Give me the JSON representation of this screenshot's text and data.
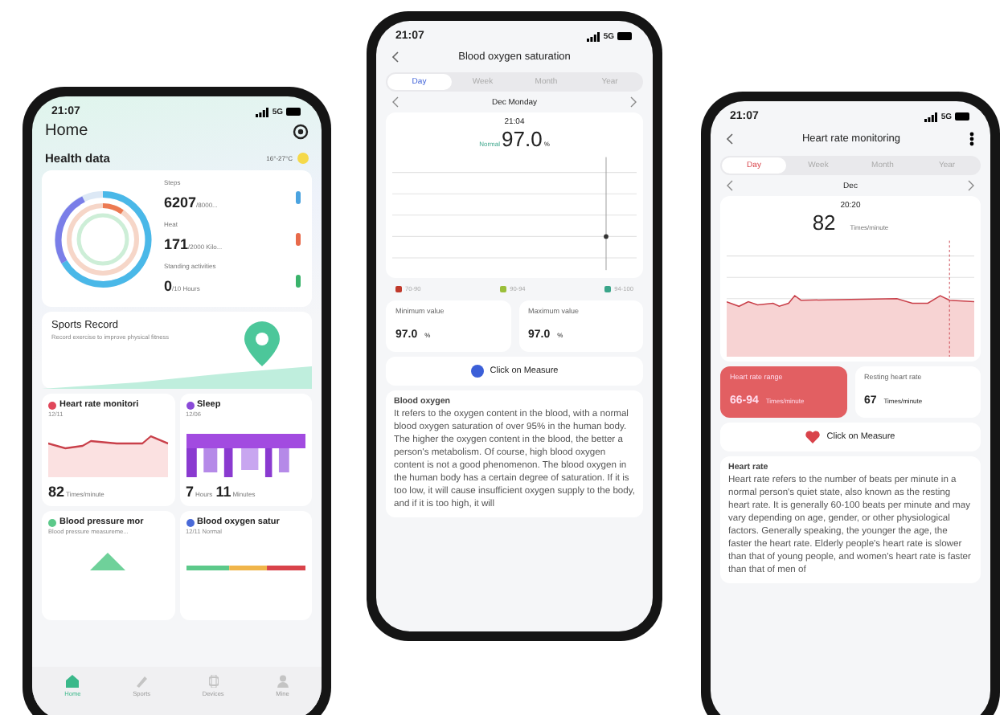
{
  "home_screen": {
    "status": {
      "time": "21:07",
      "network": "5G"
    },
    "title": "Home",
    "section": "Health data",
    "weather": "16°-27°C",
    "metrics": [
      {
        "label": "Steps",
        "value": "6207",
        "unit": "/8000...",
        "kind": "steps"
      },
      {
        "label": "Heat",
        "value": "171",
        "unit": "/2000 Kilo...",
        "kind": "heat"
      },
      {
        "label": "Standing activities",
        "value": "0",
        "unit": "/10 Hours",
        "kind": "stand"
      }
    ],
    "sports": {
      "title": "Sports Record",
      "subtitle": "Record exercise to improve physical fitness"
    },
    "cards": [
      {
        "kind": "heart",
        "title": "Heart rate monitori",
        "date": "12/11",
        "parts": [
          {
            "value": "82",
            "unit": "Times/minute"
          }
        ]
      },
      {
        "kind": "sleep",
        "title": "Sleep",
        "date": "12/06",
        "parts": [
          {
            "value": "7",
            "unit": "Hours"
          },
          {
            "value": "11",
            "unit": "Minutes"
          }
        ]
      },
      {
        "kind": "pressure",
        "title": "Blood pressure mor",
        "date": "Blood pressure measureme..."
      },
      {
        "kind": "oxygen",
        "title": "Blood oxygen satur",
        "date": "12/11 Normal"
      }
    ],
    "nav": [
      {
        "label": "Home",
        "kind": "home",
        "selected": true
      },
      {
        "label": "Sports",
        "kind": "sports",
        "selected": false
      },
      {
        "label": "Devices",
        "kind": "devices",
        "selected": false
      },
      {
        "label": "Mine",
        "kind": "mine",
        "selected": false
      }
    ]
  },
  "oxygen_screen": {
    "status": {
      "time": "21:07",
      "network": "5G"
    },
    "title": "Blood oxygen saturation",
    "tabs": [
      {
        "label": "Day",
        "selected": true
      },
      {
        "label": "Week",
        "selected": false
      },
      {
        "label": "Month",
        "selected": false
      },
      {
        "label": "Year",
        "selected": false
      }
    ],
    "date": "Dec Monday",
    "time": "21:04",
    "status_label": "Normal",
    "value": "97.0",
    "unit": "%",
    "legend": [
      {
        "label": "70-90",
        "color": "#c0392b"
      },
      {
        "label": "90-94",
        "color": "#9bbf3a"
      },
      {
        "label": "94-100",
        "color": "#3aa58a"
      }
    ],
    "stats": [
      {
        "label": "Minimum value",
        "value": "97.0",
        "unit": "%"
      },
      {
        "label": "Maximum value",
        "value": "97.0",
        "unit": "%"
      }
    ],
    "measure": "Click on Measure",
    "info_title": "Blood oxygen",
    "info_text": "It refers to the oxygen content in the blood, with a normal blood oxygen saturation of over 95% in the human body. The higher the oxygen content in the blood, the better a person's metabolism. Of course, high blood oxygen content is not a good phenomenon. The blood oxygen in the human body has a certain degree of saturation. If it is too low, it will cause insufficient oxygen supply to the body, and if it is too high, it will"
  },
  "heart_screen": {
    "status": {
      "time": "21:07",
      "network": "5G"
    },
    "title": "Heart rate monitoring",
    "tabs": [
      {
        "label": "Day",
        "selected": true
      },
      {
        "label": "Week",
        "selected": false
      },
      {
        "label": "Month",
        "selected": false
      },
      {
        "label": "Year",
        "selected": false
      }
    ],
    "date": "Dec",
    "time": "20:20",
    "value": "82",
    "unit": "Times/minute",
    "range": {
      "label": "Heart rate range",
      "value": "66-94",
      "unit": "Times/minute"
    },
    "resting": {
      "label": "Resting heart rate",
      "value": "67",
      "unit": "Times/minute"
    },
    "measure": "Click on Measure",
    "info_title": "Heart rate",
    "info_text": "Heart rate refers to the number of beats per minute in a normal person's quiet state, also known as the resting heart rate. It is generally 60-100 beats per minute and may vary depending on age, gender, or other physiological factors. Generally speaking, the younger the age, the faster the heart rate. Elderly people's heart rate is slower than that of young people, and women's heart rate is faster than that of men of"
  }
}
